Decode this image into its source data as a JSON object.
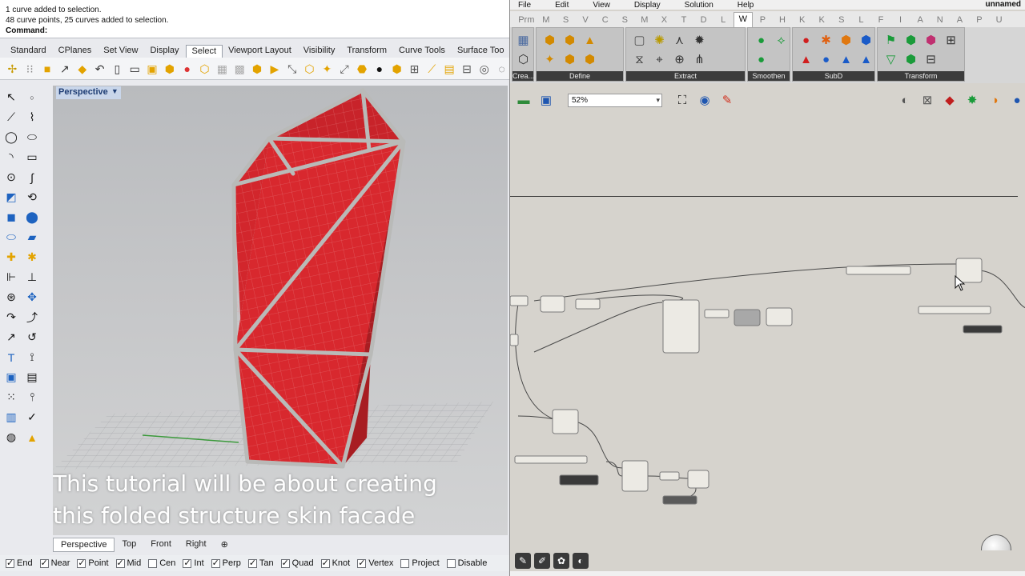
{
  "rhino": {
    "history": [
      "1 curve added to selection.",
      "48 curve points, 25 curves added to selection."
    ],
    "command_label": "Command:",
    "tabs": [
      "Standard",
      "CPlanes",
      "Set View",
      "Display",
      "Select",
      "Viewport Layout",
      "Visibility",
      "Transform",
      "Curve Tools",
      "Surface Too"
    ],
    "active_tab": "Select",
    "ribbon_icons": [
      "point-icon",
      "select-icon",
      "crosshair-icon",
      "select-by-color-icon"
    ],
    "viewport_name": "Perspective",
    "viewport_tabs": [
      "Perspective",
      "Top",
      "Front",
      "Right"
    ],
    "add_tab_symbol": "⊕",
    "caption_line1": "This tutorial will be about creating",
    "caption_line2": "this folded structure skin facade",
    "surface_color": "#d2262c",
    "frame_color": "#b9bab8",
    "osnaps": [
      {
        "label": "End",
        "checked": true
      },
      {
        "label": "Near",
        "checked": true
      },
      {
        "label": "Point",
        "checked": true
      },
      {
        "label": "Mid",
        "checked": true
      },
      {
        "label": "Cen",
        "checked": false
      },
      {
        "label": "Int",
        "checked": true
      },
      {
        "label": "Perp",
        "checked": true
      },
      {
        "label": "Tan",
        "checked": true
      },
      {
        "label": "Quad",
        "checked": true
      },
      {
        "label": "Knot",
        "checked": true
      },
      {
        "label": "Vertex",
        "checked": true
      },
      {
        "label": "Project",
        "checked": false
      },
      {
        "label": "Disable",
        "checked": false
      }
    ]
  },
  "grasshopper": {
    "menu": [
      "File",
      "Edit",
      "View",
      "Display",
      "Solution",
      "Help"
    ],
    "file_name": "unnamed",
    "tabs": [
      "Prm",
      "M",
      "S",
      "V",
      "C",
      "S",
      "M",
      "X",
      "T",
      "D",
      "L",
      "W",
      "P",
      "H",
      "K",
      "K",
      "S",
      "L",
      "F",
      "I",
      "A",
      "N",
      "A",
      "P",
      "U"
    ],
    "active_tab": "W",
    "groups": [
      {
        "label": "Crea..."
      },
      {
        "label": "Define"
      },
      {
        "label": "Extract"
      },
      {
        "label": "Smoothen"
      },
      {
        "label": "SubD"
      },
      {
        "label": "Transform"
      }
    ],
    "zoom": "52%"
  }
}
